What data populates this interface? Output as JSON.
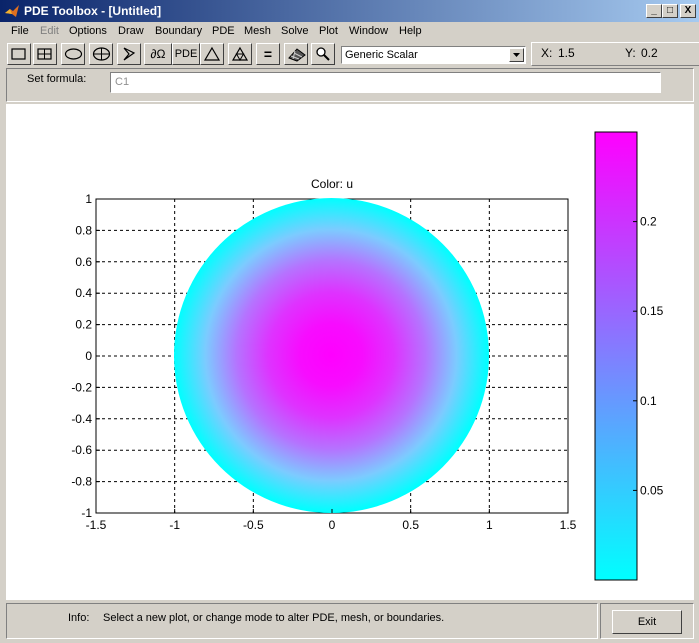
{
  "window": {
    "title": "PDE Toolbox - [Untitled]",
    "controls": {
      "minimize": "_",
      "maximize": "□",
      "close": "X"
    }
  },
  "menu": [
    {
      "label": "File",
      "enabled": true
    },
    {
      "label": "Edit",
      "enabled": false
    },
    {
      "label": "Options",
      "enabled": true
    },
    {
      "label": "Draw",
      "enabled": true
    },
    {
      "label": "Boundary",
      "enabled": true
    },
    {
      "label": "PDE",
      "enabled": true
    },
    {
      "label": "Mesh",
      "enabled": true
    },
    {
      "label": "Solve",
      "enabled": true
    },
    {
      "label": "Plot",
      "enabled": true
    },
    {
      "label": "Window",
      "enabled": true
    },
    {
      "label": "Help",
      "enabled": true
    }
  ],
  "toolbar": {
    "buttons": [
      {
        "icon": "rectangle-icon"
      },
      {
        "icon": "centered-rectangle-icon"
      },
      {
        "icon": "ellipse-icon"
      },
      {
        "icon": "centered-ellipse-icon"
      },
      {
        "icon": "polygon-icon"
      },
      {
        "icon": "boundary-mode-icon",
        "label": "∂Ω"
      },
      {
        "icon": "pde-spec-icon",
        "label": "PDE"
      },
      {
        "icon": "init-mesh-icon"
      },
      {
        "icon": "refine-mesh-icon"
      },
      {
        "icon": "solve-icon",
        "label": "="
      },
      {
        "icon": "plot-3d-icon"
      },
      {
        "icon": "zoom-icon"
      }
    ],
    "application_mode": "Generic Scalar"
  },
  "coords": {
    "x_label": "X:",
    "x_value": "1.5",
    "y_label": "Y:",
    "y_value": "0.2"
  },
  "formula": {
    "label": "Set formula:",
    "value": "C1"
  },
  "chart_data": {
    "type": "heatmap",
    "title": "Color: u",
    "xlim": [
      -1.5,
      1.5
    ],
    "ylim": [
      -1,
      1
    ],
    "xticks": [
      "-1.5",
      "-1",
      "-0.5",
      "0",
      "0.5",
      "1",
      "1.5"
    ],
    "yticks": [
      "-1",
      "-0.8",
      "-0.6",
      "-0.4",
      "-0.2",
      "0",
      "0.2",
      "0.4",
      "0.6",
      "0.8",
      "1"
    ],
    "grid": true,
    "domain": "unit circle",
    "field": "u = (1 - x^2 - y^2) / 4",
    "colormap": [
      "#00ffff",
      "#ff00ff"
    ],
    "colorbar": {
      "range": [
        0,
        0.25
      ],
      "ticks": [
        "0.05",
        "0.1",
        "0.15",
        "0.2"
      ]
    }
  },
  "status": {
    "info_label": "Info:",
    "info_text": "Select a new plot, or change mode to alter PDE, mesh, or boundaries.",
    "exit_label": "Exit"
  }
}
